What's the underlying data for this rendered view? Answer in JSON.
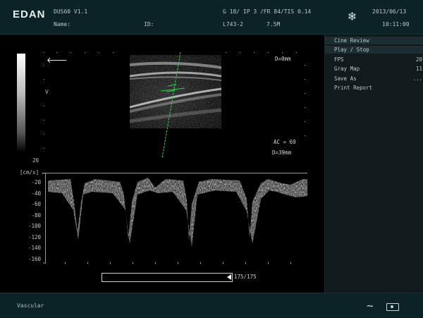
{
  "header": {
    "brand": "EDAN",
    "model": "DUS60 V1.1",
    "name_label": "Name:",
    "id_label": "ID:",
    "params": "G 18/ IP 3 /FR 84/TIS 0.14",
    "probe": "L743-2",
    "depth": "7.5M",
    "date": "2013/06/13",
    "time": "10:11:00",
    "freeze_icon": "snowflake-icon"
  },
  "menu": {
    "items": [
      {
        "label": "Cine Review",
        "value": "",
        "highlighted": true
      },
      {
        "label": "Play / Stop",
        "value": "",
        "highlighted": true
      },
      {
        "label": "FPS",
        "value": "20",
        "highlighted": false
      },
      {
        "label": "Gray Map",
        "value": "11",
        "highlighted": false
      },
      {
        "label": "Save As",
        "value": "...",
        "highlighted": false
      },
      {
        "label": "Print Report",
        "value": "",
        "highlighted": false
      }
    ]
  },
  "image": {
    "d_top": "D=0mm",
    "ac": "AC = 69",
    "d_bottom": "D=39mm",
    "scale_top": "20",
    "side_marker": "V"
  },
  "doppler": {
    "unit": "[cm/s]",
    "ticks": [
      "-20",
      "-40",
      "-60",
      "-80",
      "-100",
      "-120",
      "-140",
      "-160"
    ]
  },
  "cine": {
    "position": 1.0,
    "counter": "175/175"
  },
  "footer": {
    "preset": "Vascular",
    "icons": [
      "waveform-icon",
      "camera-icon"
    ]
  }
}
